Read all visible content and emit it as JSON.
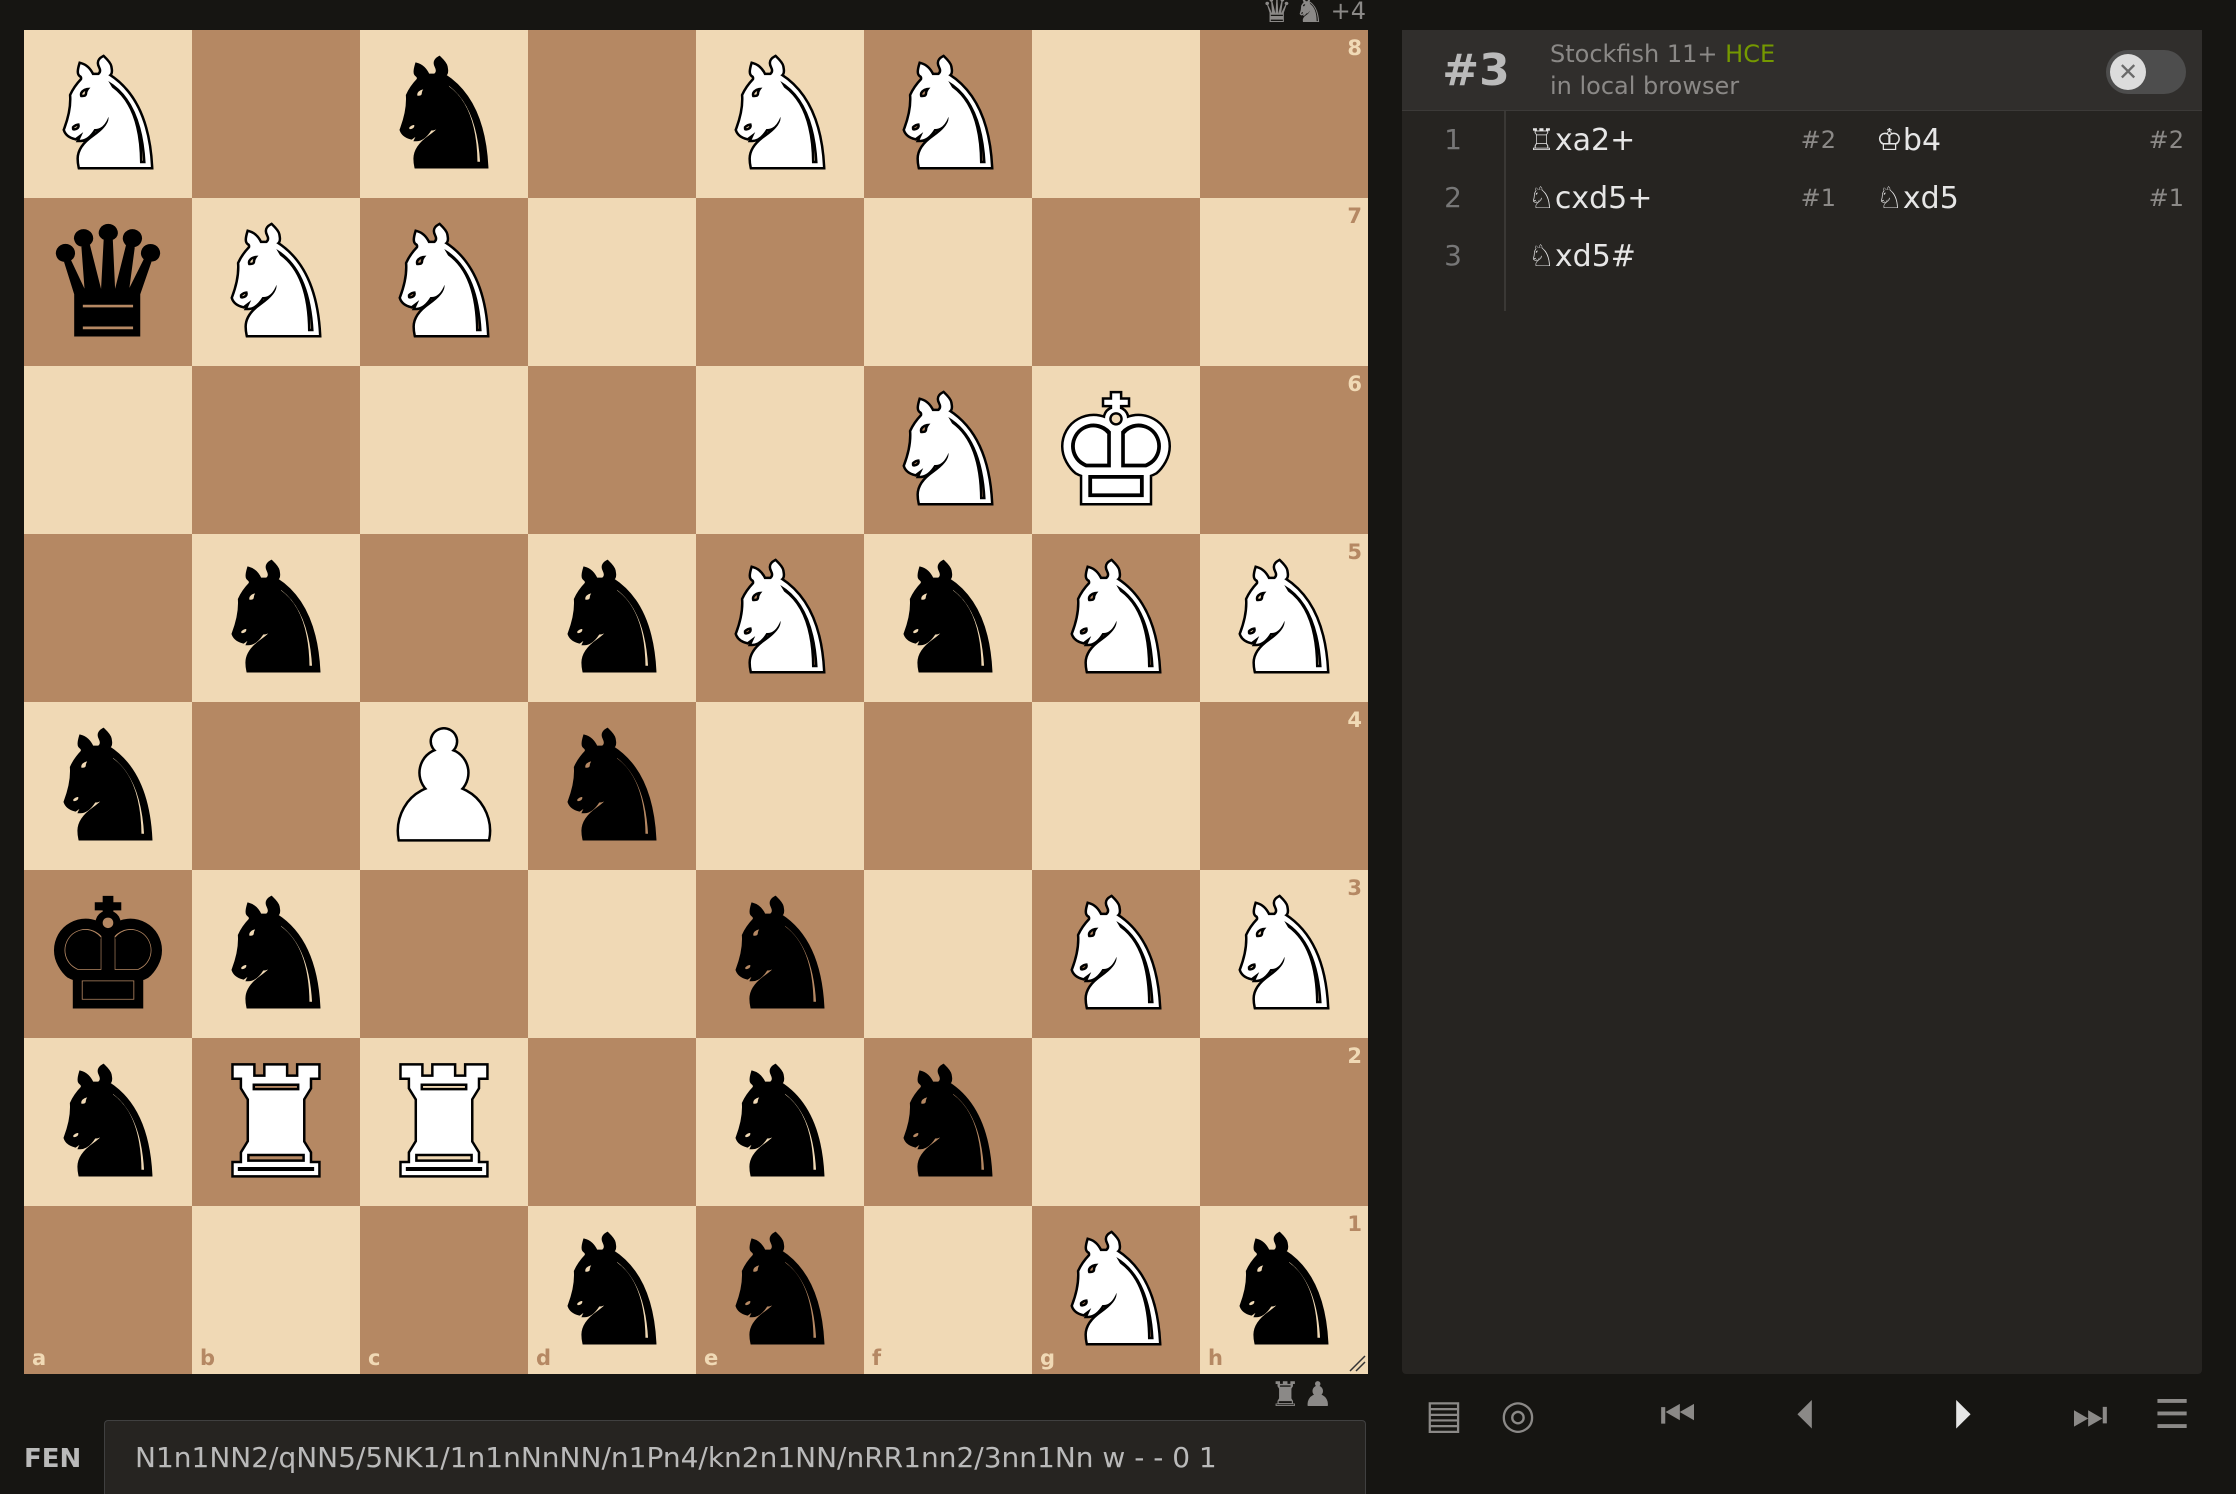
{
  "board": {
    "ranks": [
      [
        "wN",
        "",
        "bN",
        "",
        "wN",
        "wN",
        "",
        ""
      ],
      [
        "bQ",
        "wN",
        "wN",
        "",
        "",
        "",
        "",
        ""
      ],
      [
        "",
        "",
        "",
        "",
        "",
        "wN",
        "wK",
        ""
      ],
      [
        "",
        "bN",
        "",
        "bN",
        "wN",
        "bN",
        "wN",
        "wN"
      ],
      [
        "bN",
        "",
        "wP",
        "bN",
        "",
        "",
        "",
        ""
      ],
      [
        "bK",
        "bN",
        "",
        "",
        "bN",
        "",
        "wN",
        "wN"
      ],
      [
        "bN",
        "wR",
        "wR",
        "",
        "bN",
        "bN",
        "",
        ""
      ],
      [
        "",
        "",
        "",
        "bN",
        "bN",
        "",
        "wN",
        "bN"
      ]
    ],
    "rank_labels": [
      "8",
      "7",
      "6",
      "5",
      "4",
      "3",
      "2",
      "1"
    ],
    "file_labels": [
      "a",
      "b",
      "c",
      "d",
      "e",
      "f",
      "g",
      "h"
    ],
    "colors": {
      "light": "#f0d9b5",
      "dark": "#b58863"
    }
  },
  "material_top": {
    "pieces": [
      "queen-icon",
      "knight-icon"
    ],
    "glyphs": [
      "♛",
      "♞"
    ],
    "advantage": "+4"
  },
  "material_bottom": {
    "pieces": [
      "rook-icon",
      "pawn-icon"
    ],
    "glyphs": [
      "♜",
      "♟"
    ]
  },
  "fen": {
    "label": "FEN",
    "value": "N1n1NN2/qNN5/5NK1/1n1nNnNN/n1Pn4/kn2n1NN/nRR1nn2/3nn1Nn w - - 0 1"
  },
  "engine": {
    "score": "#3",
    "name": "Stockfish 11+",
    "variant": "HCE",
    "location": "in local browser",
    "toggle_glyph": "✕"
  },
  "moves": [
    {
      "num": "1",
      "white": "♖xa2+",
      "white_mate": "#2",
      "black": "♔b4",
      "black_mate": "#2"
    },
    {
      "num": "2",
      "white": "♘cxd5+",
      "white_mate": "#1",
      "black": "♘xd5",
      "black_mate": "#1"
    },
    {
      "num": "3",
      "white": "♘xd5#",
      "white_mate": "",
      "black": "",
      "black_mate": ""
    }
  ],
  "controls": {
    "book": "▤",
    "target": "◎",
    "first": "⏮",
    "prev": "⏴",
    "next": "⏵",
    "last": "⏭",
    "menu": "☰"
  }
}
